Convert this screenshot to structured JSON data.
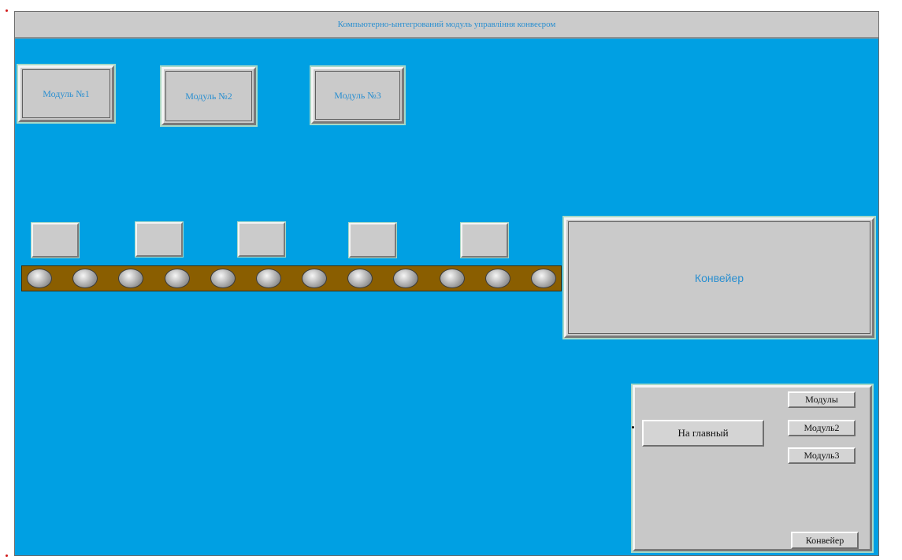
{
  "window": {
    "title": "Компьютерно-ынтегрований модуль управління конвеєром"
  },
  "modules": [
    {
      "label": "Модуль №1"
    },
    {
      "label": "Модуль №2"
    },
    {
      "label": "Модуль №3"
    }
  ],
  "conveyor": {
    "label": "Конвейер",
    "blocks_count": 5,
    "rollers_count": 12,
    "colors": {
      "background": "#00a0e3",
      "belt": "#8a5e00",
      "panel": "#cbcbcb",
      "label_text": "#2a8fd0"
    }
  },
  "navigation": {
    "home_button": "На главный",
    "module1_button": "Модулы",
    "module2_button": "Модуль2",
    "module3_button": "Модуль3",
    "conveyor_button": "Конвейер"
  }
}
